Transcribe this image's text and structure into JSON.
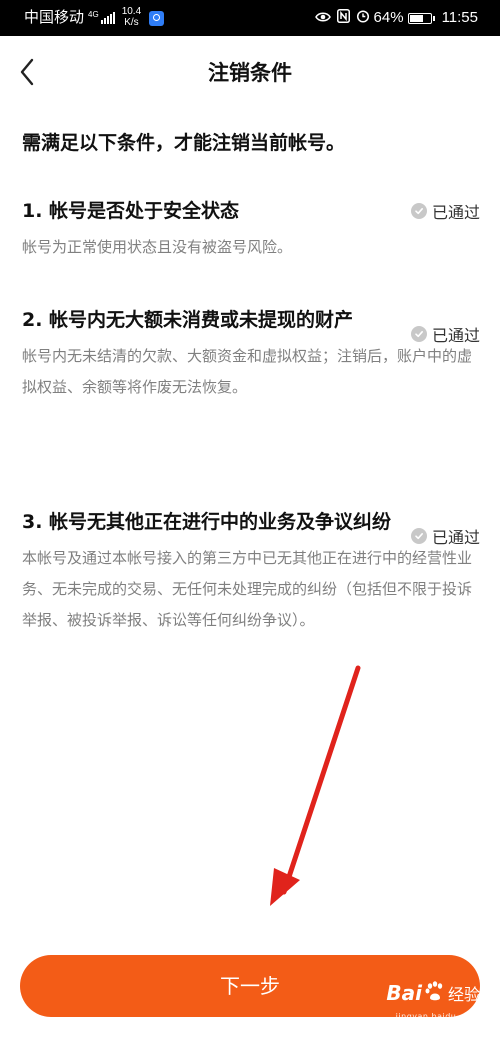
{
  "status_bar": {
    "carrier": "中国移动",
    "network": "4G",
    "speed_value": "10.4",
    "speed_unit": "K/s",
    "battery": "64%",
    "time": "11:55"
  },
  "header": {
    "title": "注销条件"
  },
  "intro": "需满足以下条件，才能注销当前帐号。",
  "conditions": [
    {
      "title": "1. 帐号是否处于安全状态",
      "status": "已通过",
      "description": "帐号为正常使用状态且没有被盗号风险。"
    },
    {
      "title": "2. 帐号内无大额未消费或未提现的财产",
      "status": "已通过",
      "description": "帐号内无未结清的欠款、大额资金和虚拟权益；注销后，账户中的虚拟权益、余额等将作废无法恢复。"
    },
    {
      "title": "3. 帐号无其他正在进行中的业务及争议纠纷",
      "status": "已通过",
      "description": "本帐号及通过本帐号接入的第三方中已无其他正在进行中的经营性业务、无未完成的交易、无任何未处理完成的纠纷（包括但不限于投诉举报、被投诉举报、诉讼等任何纠纷争议）。"
    }
  ],
  "next_button": "下一步",
  "watermark": {
    "brand": "Bai",
    "suffix": "经验",
    "url": "jingyan.baidu.com"
  },
  "colors": {
    "accent": "#f35c17",
    "status_check": "#c8c8c8",
    "annotation_arrow": "#e0231c"
  },
  "icons": [
    "back-arrow-icon",
    "check-circle-icon",
    "eye-icon",
    "nfc-icon",
    "alarm-icon",
    "battery-icon",
    "signal-icon",
    "app-notification-icon",
    "annotation-arrow-icon",
    "baidu-paw-icon"
  ]
}
